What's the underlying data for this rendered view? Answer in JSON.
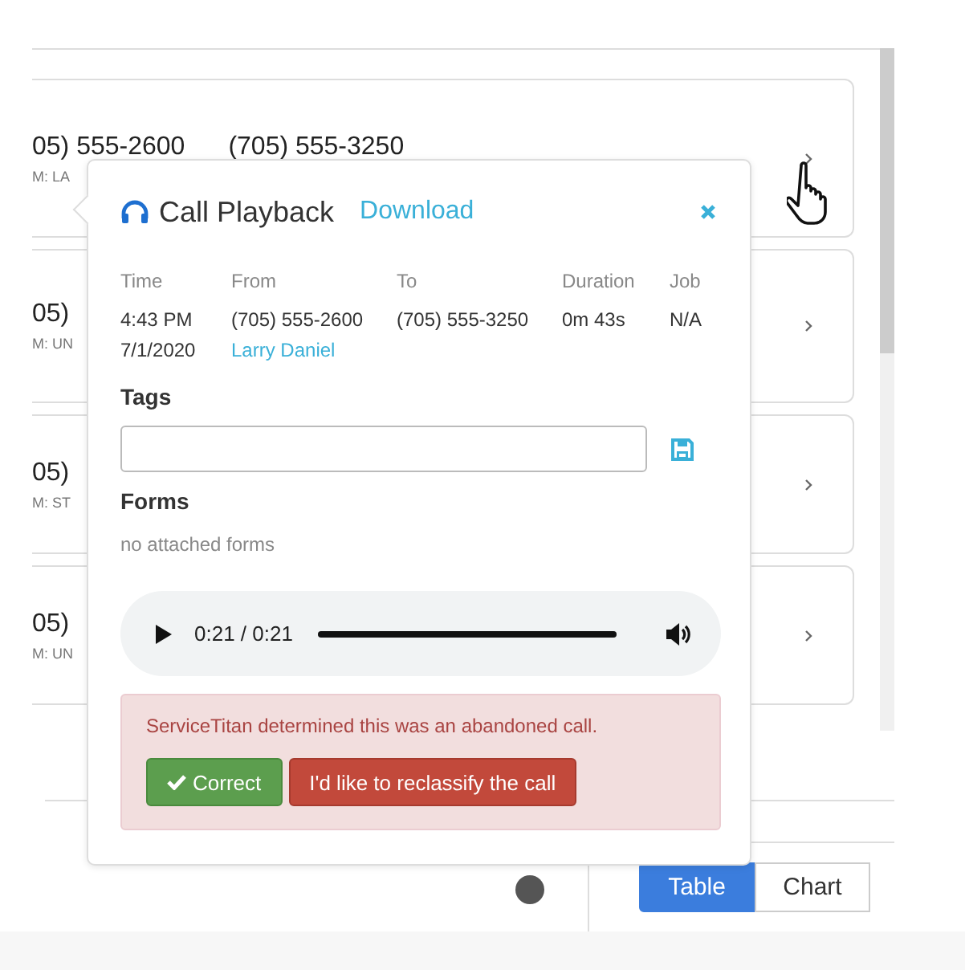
{
  "call_list": {
    "rows": [
      {
        "from": "05) 555-2600",
        "to": "(705) 555-3250",
        "subtitle": "M: LA"
      },
      {
        "from": "05)",
        "subtitle": "M: UN"
      },
      {
        "from": "05)",
        "subtitle": "M: ST"
      },
      {
        "from": "05)",
        "subtitle": "M: UN"
      }
    ]
  },
  "view_tabs": [
    {
      "label": "Table",
      "selected": true
    },
    {
      "label": "Chart",
      "selected": false
    }
  ],
  "popup": {
    "title": "Call Playback",
    "download": "Download",
    "columns": [
      {
        "header": "Time",
        "values": [
          {
            "text": "4:43 PM",
            "kind": "text"
          },
          {
            "text": "7/1/2020",
            "kind": "text"
          }
        ]
      },
      {
        "header": "From",
        "values": [
          {
            "text": "(705) 555-2600",
            "kind": "text"
          },
          {
            "text": "Larry Daniel",
            "kind": "link"
          }
        ]
      },
      {
        "header": "To",
        "values": [
          {
            "text": "(705) 555-3250",
            "kind": "text"
          }
        ]
      },
      {
        "header": "Duration",
        "values": [
          {
            "text": "0m 43s",
            "kind": "text"
          }
        ]
      },
      {
        "header": "Job",
        "values": [
          {
            "text": "N/A",
            "kind": "text"
          }
        ]
      }
    ],
    "tags_label": "Tags",
    "forms_label": "Forms",
    "forms_empty": "no attached forms",
    "audio": {
      "time": "0:21 / 0:21",
      "level": 1
    },
    "alert": {
      "message": "ServiceTitan determined this was an abandoned call.",
      "buttons": [
        {
          "label": "Correct",
          "kind": "success"
        },
        {
          "label": "I'd like to reclassify the call",
          "kind": "danger"
        }
      ]
    }
  }
}
